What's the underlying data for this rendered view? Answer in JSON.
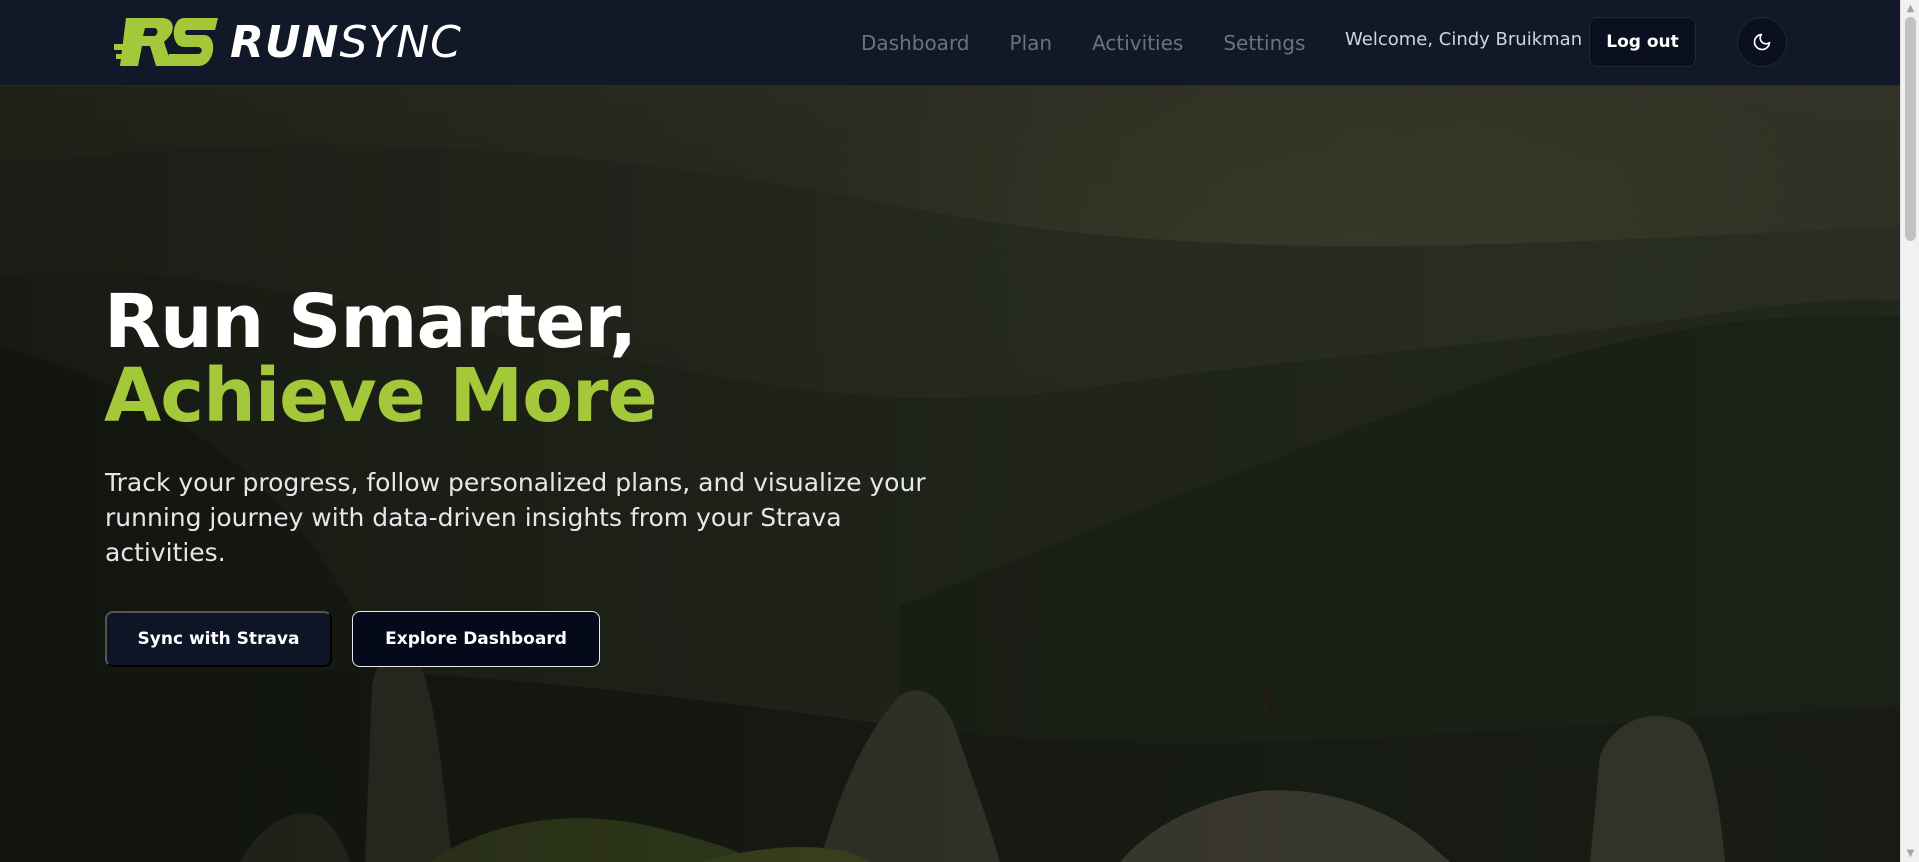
{
  "brand": {
    "name_bold": "RUN",
    "name_light": "SYNC",
    "accent_color": "#a3c93a"
  },
  "nav": {
    "items": [
      {
        "label": "Dashboard"
      },
      {
        "label": "Plan"
      },
      {
        "label": "Activities"
      },
      {
        "label": "Settings"
      }
    ]
  },
  "user": {
    "welcome_text": "Welcome, Cindy Bruikman",
    "logout_label": "Log out",
    "theme_icon": "moon-icon"
  },
  "hero": {
    "headline_line1": "Run Smarter,",
    "headline_line2": "Achieve More",
    "subtitle": "Track your progress, follow personalized plans, and visualize your running journey with data-driven insights from your Strava activities.",
    "primary_button": "Sync with Strava",
    "secondary_button": "Explore Dashboard",
    "background_image": "mountain-landscape"
  }
}
